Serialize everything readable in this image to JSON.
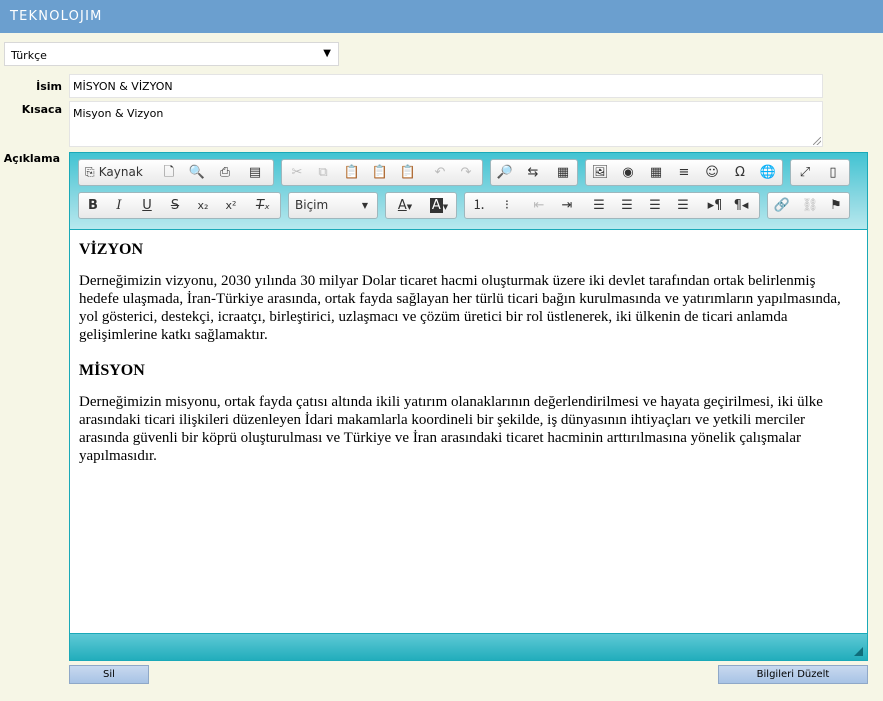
{
  "header": {
    "logo": "TEKNOLOJIM"
  },
  "language": {
    "selected": "Türkçe",
    "arrow": "▼"
  },
  "form": {
    "name_label": "İsim",
    "name_value": "MİSYON & VİZYON",
    "short_label": "Kısaca",
    "short_value": "Misyon & Vizyon",
    "desc_label": "Açıklama"
  },
  "toolbar": {
    "source_label": "Kaynak",
    "format_label": "Biçim"
  },
  "content": {
    "heading1": "VİZYON",
    "para1": "Derneğimizin vizyonu, 2030 yılında 30 milyar Dolar ticaret hacmi oluşturmak üzere iki devlet tarafından ortak belirlenmiş hedefe ulaşmada, İran-Türkiye arasında, ortak fayda sağlayan her türlü ticari bağın kurulmasında ve yatırımların yapılmasında, yol gösterici, destekçi, icraatçı, birleştirici, uzlaşmacı ve çözüm üretici bir rol üstlenerek, iki ülkenin de ticari anlamda gelişimlerine katkı sağlamaktır.",
    "heading2": "MİSYON",
    "para2": "Derneğimizin misyonu, ortak fayda çatısı altında ikili yatırım olanaklarının değerlendirilmesi ve hayata geçirilmesi, iki ülke arasındaki ticari ilişkileri düzenleyen İdari makamlarla  koordineli bir şekilde, iş dünyasının ihtiyaçları ve yetkili merciler arasında güvenli bir köprü oluşturulması ve Türkiye ve İran arasındaki ticaret hacminin arttırılmasına yönelik çalışmalar yapılmasıdır."
  },
  "actions": {
    "delete_label": "Sil",
    "update_label": "Bilgileri Düzelt"
  },
  "colors": {
    "topbar": "#6b9fcf",
    "page_bg": "#f6f6e6",
    "editor_accent": "#1aa9b8"
  }
}
